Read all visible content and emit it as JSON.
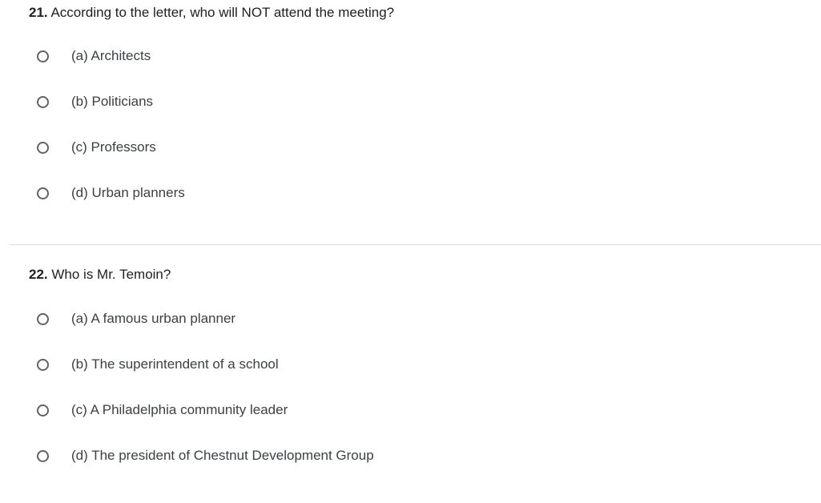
{
  "questions": [
    {
      "number": "21.",
      "text": "According to the letter, who will NOT attend the meeting?",
      "options": [
        "(a) Architects",
        "(b) Politicians",
        "(c) Professors",
        "(d) Urban planners"
      ]
    },
    {
      "number": "22.",
      "text": "Who is Mr. Temoin?",
      "options": [
        "(a) A famous urban planner",
        "(b) The superintendent of a school",
        "(c) A Philadelphia community leader",
        "(d) The president of Chestnut Development Group"
      ]
    }
  ]
}
